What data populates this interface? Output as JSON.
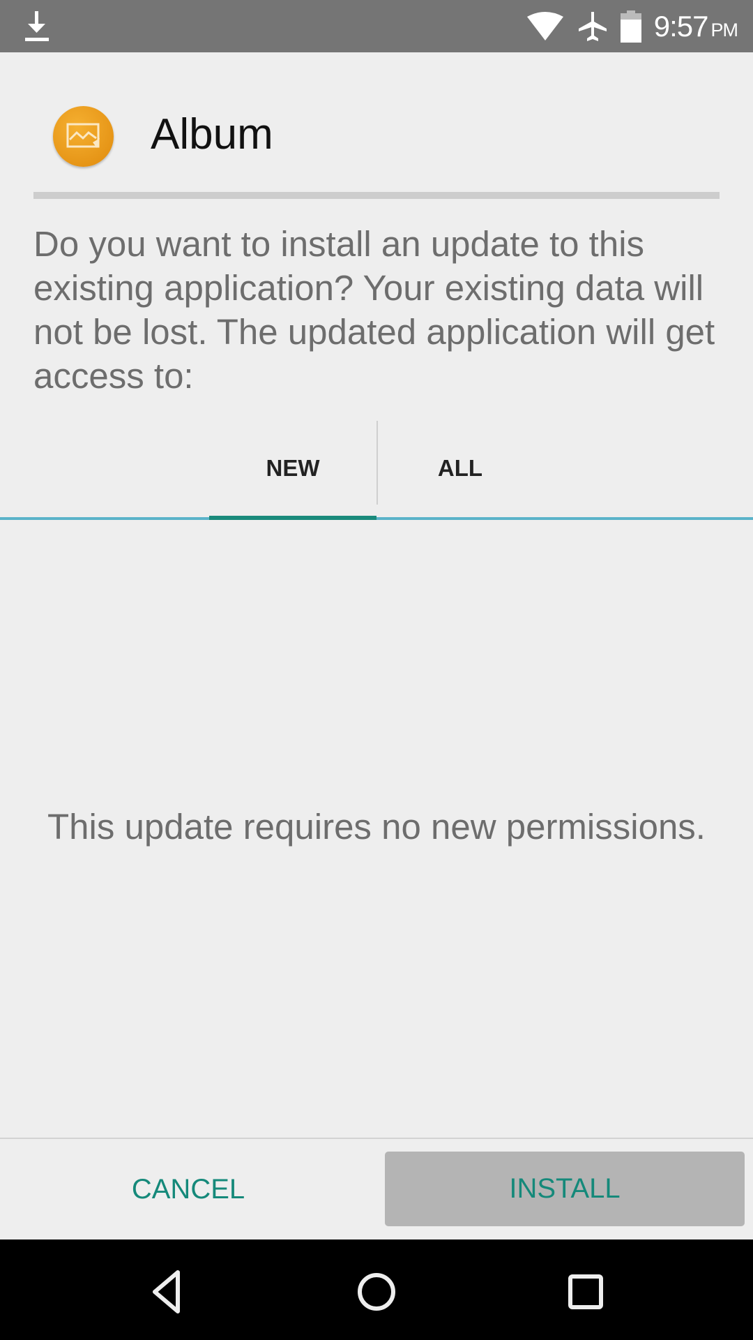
{
  "status_bar": {
    "time": "9:57",
    "ampm": "PM",
    "icons": [
      "download-icon",
      "wifi-icon",
      "airplane-mode-icon",
      "battery-icon"
    ]
  },
  "app": {
    "name": "Album",
    "icon": "album-app-icon",
    "icon_color": "#E9960F"
  },
  "dialog": {
    "message": "Do you want to install an update to this existing application? Your existing data will not be lost. The updated application will get access to:",
    "tabs": [
      {
        "label": "NEW",
        "selected": true
      },
      {
        "label": "ALL",
        "selected": false
      }
    ],
    "permissions_message": "This update requires no new permissions.",
    "cancel_label": "CANCEL",
    "install_label": "INSTALL",
    "accent_color": "#15897A"
  },
  "nav_bar": {
    "buttons": [
      "back-icon",
      "home-icon",
      "recents-icon"
    ]
  }
}
